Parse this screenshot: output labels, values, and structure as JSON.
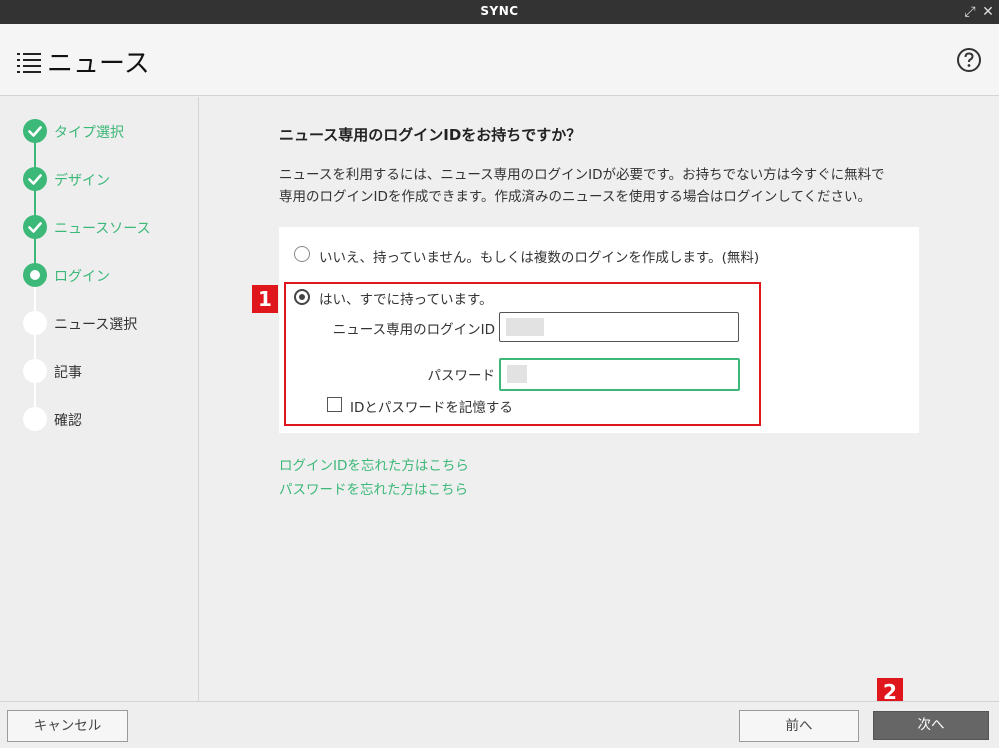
{
  "window": {
    "title": "SYNC"
  },
  "header": {
    "title": "ニュース"
  },
  "steps": [
    {
      "label": "タイプ選択",
      "state": "done"
    },
    {
      "label": "デザイン",
      "state": "done"
    },
    {
      "label": "ニュースソース",
      "state": "done"
    },
    {
      "label": "ログイン",
      "state": "current"
    },
    {
      "label": "ニュース選択",
      "state": "todo"
    },
    {
      "label": "記事",
      "state": "todo"
    },
    {
      "label": "確認",
      "state": "todo"
    }
  ],
  "main": {
    "question": "ニュース専用のログインIDをお持ちですか？",
    "description_line1": "ニュースを利用するには、ニュース専用のログインIDが必要です。お持ちでない方は今すぐに無料で",
    "description_line2": "専用のログインIDを作成できます。作成済みのニュースを使用する場合はログインしてください。",
    "option_no": "いいえ、持っていません。もしくは複数のログインを作成します。(無料)",
    "option_yes": "はい、すでに持っています。",
    "login_id_label": "ニュース専用のログインID",
    "password_label": "パスワード",
    "remember_label": "IDとパスワードを記憶する",
    "forgot_id_link": "ログインIDを忘れた方はこちら",
    "forgot_password_link": "パスワードを忘れた方はこちら"
  },
  "badges": {
    "one": "1",
    "two": "2"
  },
  "footer": {
    "cancel": "キャンセル",
    "back": "前へ",
    "next": "次へ"
  },
  "colors": {
    "accent": "#3cb878",
    "highlight": "#e0161d",
    "titlebar": "#333333"
  }
}
